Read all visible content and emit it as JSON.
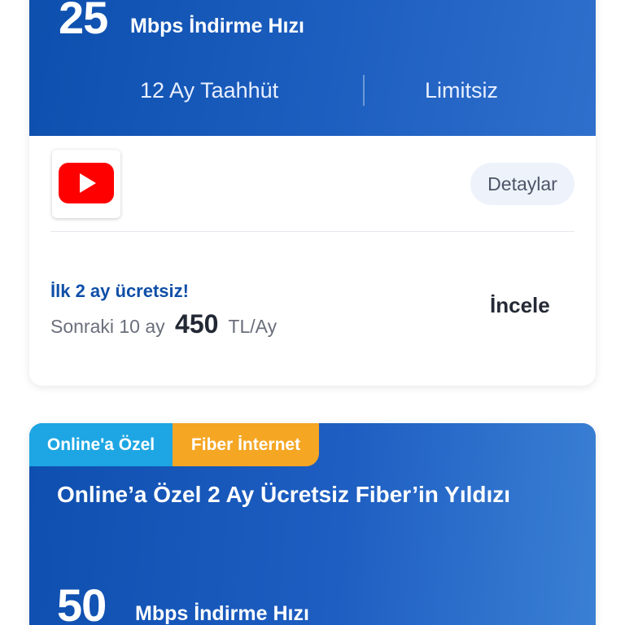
{
  "plan1": {
    "speed_value": "25",
    "speed_unit": "Mbps İndirme Hızı",
    "commitment": "12 Ay Taahhüt",
    "quota": "Limitsiz",
    "app_icon": "youtube-icon",
    "details_label": "Detaylar",
    "promo_text": "İlk 2 ay ücretsiz!",
    "price_prefix": "Sonraki 10 ay",
    "price_amount": "450",
    "price_suffix": "TL/Ay",
    "review_label": "İncele"
  },
  "plan2": {
    "tags": [
      "Online'a Özel",
      "Fiber İnternet"
    ],
    "title": "Online’a Özel 2 Ay Ücretsiz Fiber’in Yıldızı",
    "speed_value": "50",
    "speed_unit": "Mbps İndirme Hızı"
  },
  "colors": {
    "hero_blue": "#1558b8",
    "promo_blue": "#0f4fa8",
    "tag_online": "#1da6e3",
    "tag_fiber": "#f5a623",
    "youtube_red": "#ff0000"
  }
}
